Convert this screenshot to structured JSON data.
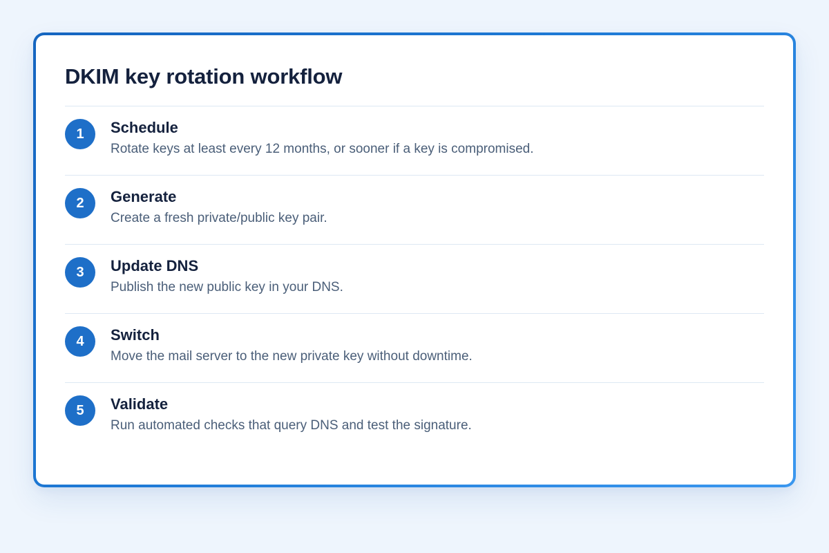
{
  "card": {
    "title": "DKIM key rotation workflow"
  },
  "steps": [
    {
      "number": "1",
      "title": "Schedule",
      "description": "Rotate keys at least every 12 months, or sooner if a key is compromised."
    },
    {
      "number": "2",
      "title": "Generate",
      "description": "Create a fresh private/public key pair."
    },
    {
      "number": "3",
      "title": "Update DNS",
      "description": "Publish the new public key in your DNS."
    },
    {
      "number": "4",
      "title": "Switch",
      "description": "Move the mail server to the new private key without downtime."
    },
    {
      "number": "5",
      "title": "Validate",
      "description": "Run automated checks that query DNS and test the signature."
    }
  ],
  "colors": {
    "accent": "#1e6fc8",
    "border_start": "#1565c0",
    "border_end": "#3a97ef",
    "title": "#14213d",
    "description": "#4a5e78",
    "background": "#eef5fd"
  }
}
